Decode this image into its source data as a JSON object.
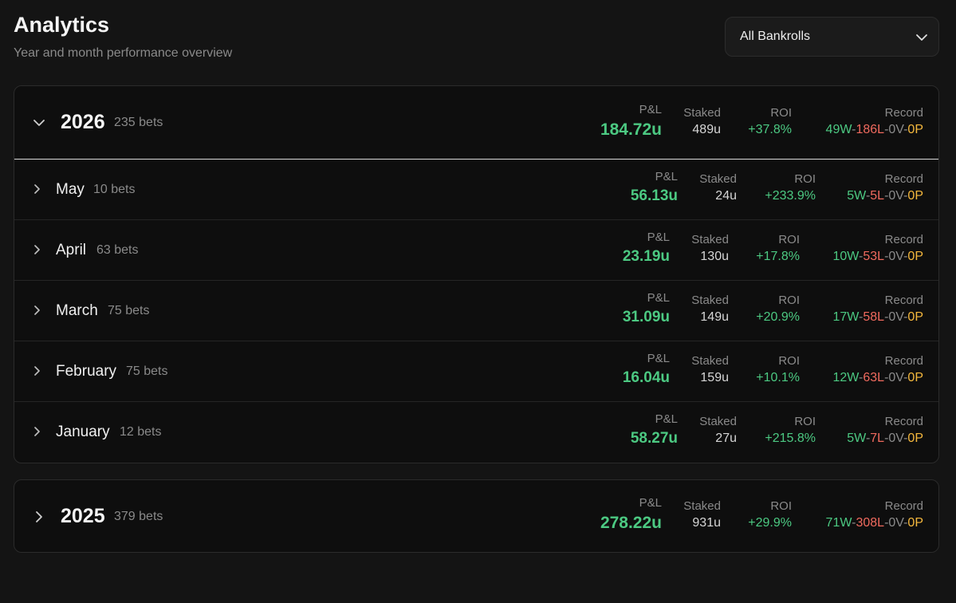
{
  "header": {
    "title": "Analytics",
    "subtitle": "Year and month performance overview"
  },
  "bankroll_select": {
    "value": "All Bankrolls",
    "icon": "chevron-down-icon"
  },
  "labels": {
    "pnl": "P&L",
    "staked": "Staked",
    "roi": "ROI",
    "record": "Record"
  },
  "years": [
    {
      "year": "2026",
      "count": "235 bets",
      "expanded": true,
      "pnl": "184.72u",
      "staked": "489u",
      "roi": "+37.8%",
      "record": {
        "w": "49W",
        "l": "186L",
        "v": "0V",
        "p": "0P"
      },
      "months": [
        {
          "name": "May",
          "count": "10 bets",
          "pnl": "56.13u",
          "staked": "24u",
          "roi": "+233.9%",
          "record": {
            "w": "5W",
            "l": "5L",
            "v": "0V",
            "p": "0P"
          }
        },
        {
          "name": "April",
          "count": "63 bets",
          "pnl": "23.19u",
          "staked": "130u",
          "roi": "+17.8%",
          "record": {
            "w": "10W",
            "l": "53L",
            "v": "0V",
            "p": "0P"
          }
        },
        {
          "name": "March",
          "count": "75 bets",
          "pnl": "31.09u",
          "staked": "149u",
          "roi": "+20.9%",
          "record": {
            "w": "17W",
            "l": "58L",
            "v": "0V",
            "p": "0P"
          }
        },
        {
          "name": "February",
          "count": "75 bets",
          "pnl": "16.04u",
          "staked": "159u",
          "roi": "+10.1%",
          "record": {
            "w": "12W",
            "l": "63L",
            "v": "0V",
            "p": "0P"
          }
        },
        {
          "name": "January",
          "count": "12 bets",
          "pnl": "58.27u",
          "staked": "27u",
          "roi": "+215.8%",
          "record": {
            "w": "5W",
            "l": "7L",
            "v": "0V",
            "p": "0P"
          }
        }
      ]
    },
    {
      "year": "2025",
      "count": "379 bets",
      "expanded": false,
      "pnl": "278.22u",
      "staked": "931u",
      "roi": "+29.9%",
      "record": {
        "w": "71W",
        "l": "308L",
        "v": "0V",
        "p": "0P"
      },
      "months": []
    }
  ]
}
